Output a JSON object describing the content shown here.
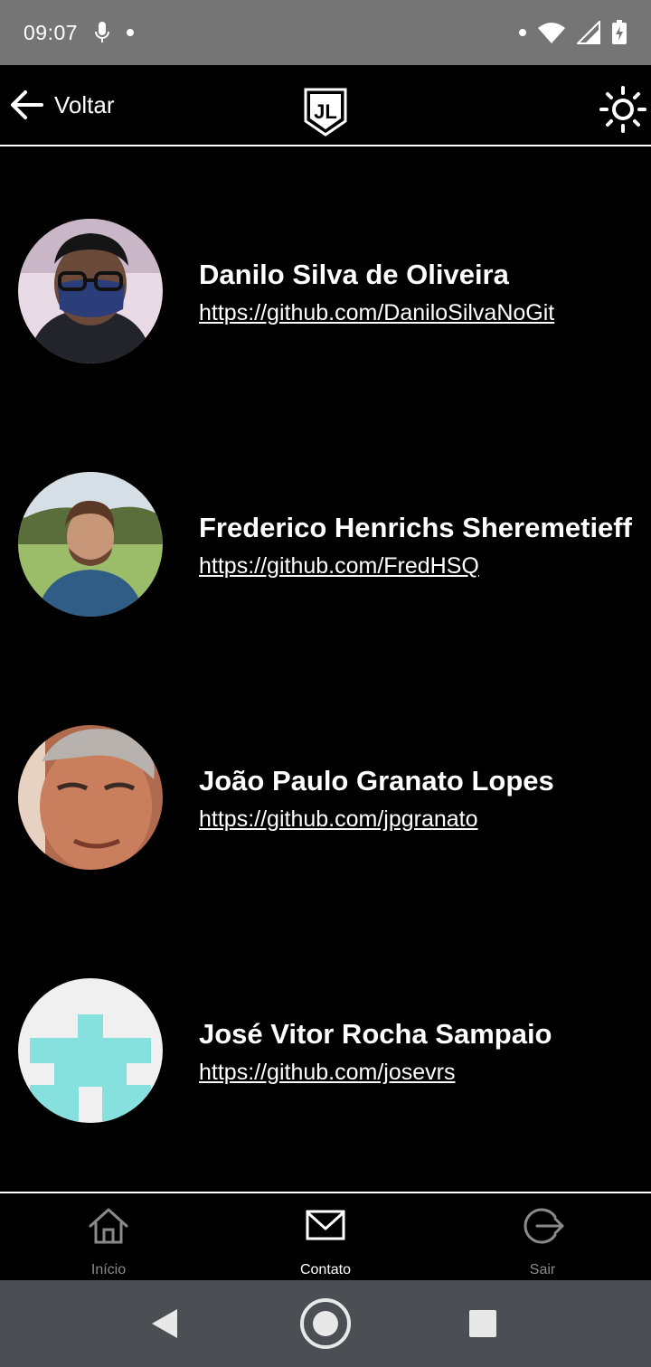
{
  "status_bar": {
    "time": "09:07"
  },
  "header": {
    "back_label": "Voltar",
    "logo_text": "JL"
  },
  "contacts": [
    {
      "name": "Danilo Silva de Oliveira",
      "link": "https://github.com/DaniloSilvaNoGit"
    },
    {
      "name": "Frederico Henrichs Sheremetieff",
      "link": "https://github.com/FredHSQ"
    },
    {
      "name": "João Paulo Granato Lopes",
      "link": "https://github.com/jpgranato"
    },
    {
      "name": "José Vitor Rocha Sampaio",
      "link": "https://github.com/josevrs"
    }
  ],
  "bottom_nav": {
    "items": [
      {
        "label": "Início",
        "icon": "home-icon",
        "active": false
      },
      {
        "label": "Contato",
        "icon": "mail-icon",
        "active": true
      },
      {
        "label": "Sair",
        "icon": "logout-icon",
        "active": false
      }
    ]
  },
  "colors": {
    "background": "#000000",
    "status_bar": "#757575",
    "system_nav": "#4b4f53",
    "nav_inactive": "#8a8a8a",
    "nav_active": "#ffffff",
    "identicon": "#86e0de"
  }
}
